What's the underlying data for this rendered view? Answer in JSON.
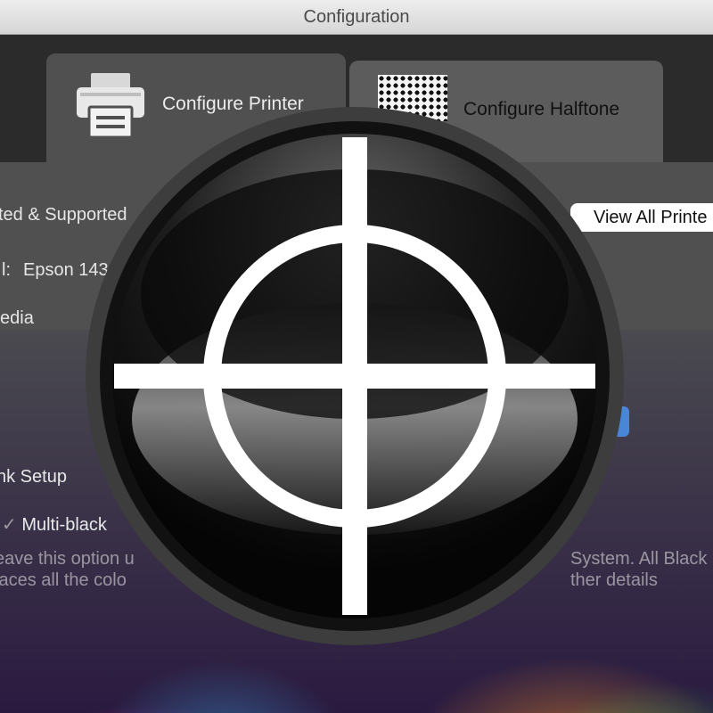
{
  "window": {
    "title": "Configuration"
  },
  "tabs": [
    {
      "label": "Configure Printer",
      "icon": "printer-icon"
    },
    {
      "label": "Configure Halftone",
      "icon": "halftone-pattern-icon"
    }
  ],
  "content": {
    "supported_label": "ted & Supported",
    "view_all_button": "View All Printe",
    "model_label": "l:",
    "model_value": "Epson 143",
    "media_label": "edia",
    "ink_setup_label": "nk Setup",
    "multiblack_label": "Multi-black",
    "help_text_line1": "eave this option u",
    "help_text_line2": "laces all the colo",
    "help_text_right1": "System. All Black",
    "help_text_right2": "ther details"
  },
  "overlay": {
    "icon": "crosshair-target-icon"
  },
  "colors": {
    "titlebar": "#e0e0e0",
    "tab_active": "#505050",
    "tab_inactive": "#5c5c5c",
    "accent_blue": "#4a86d8"
  }
}
